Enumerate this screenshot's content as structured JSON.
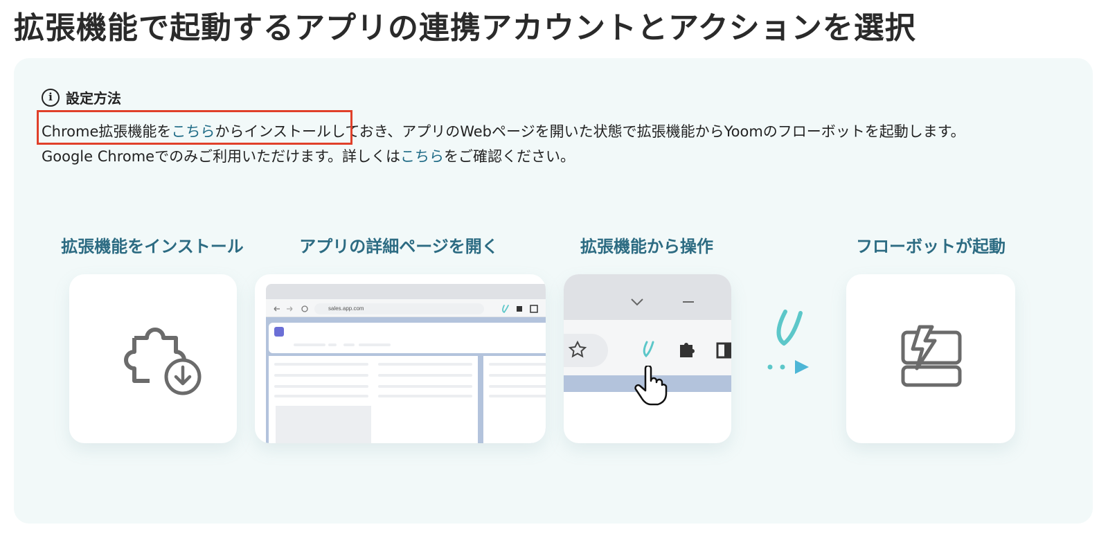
{
  "header": {
    "title": "拡張機能で起動するアプリの連携アカウントとアクションを選択"
  },
  "info": {
    "heading": "設定方法",
    "line1_prefix": "Chrome拡張機能を",
    "line1_link": "こちら",
    "line1_suffix": "からインストールしておき、アプリのWebページを開いた状態で拡張機能からYoomのフローボットを起動します。",
    "line2_prefix": "Google Chromeでのみご利用いただけます。詳しくは",
    "line2_link": "こちら",
    "line2_suffix": "をご確認ください。"
  },
  "steps": [
    {
      "label": "拡張機能をインストール"
    },
    {
      "label": "アプリの詳細ページを開く"
    },
    {
      "label": "拡張機能から操作"
    },
    {
      "label": "フローボットが起動"
    }
  ],
  "browser_mock": {
    "url": "sales.app.com"
  },
  "icons": {
    "info": "info-circle-icon",
    "puzzle_download": "puzzle-download-icon",
    "yoom_logo": "yoom-logo-icon",
    "cursor": "hand-pointer-icon",
    "bolt_robot": "lightning-robot-icon"
  },
  "colors": {
    "accent_teal": "#5cc7c9",
    "step_label": "#2c6b82",
    "link": "#1f6b86",
    "highlight_border": "#e0402a",
    "panel_bg": "#f2f9f9"
  }
}
